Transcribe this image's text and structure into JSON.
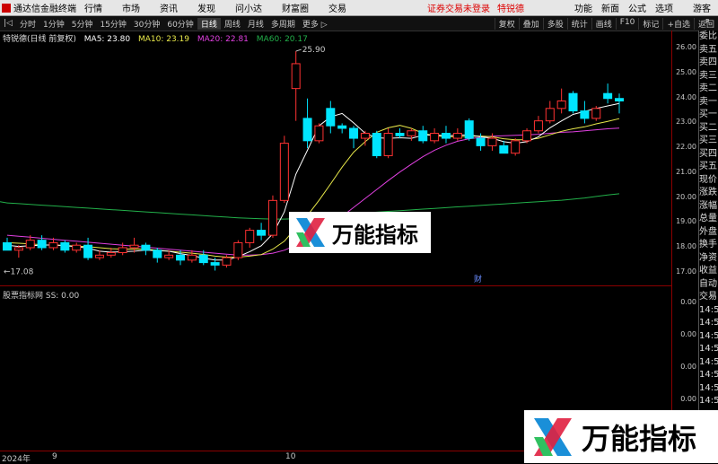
{
  "menubar": {
    "app_title": "通达信金融终端",
    "items": [
      "行情",
      "市场",
      "资讯",
      "发现",
      "问小达",
      "财富圈",
      "交易"
    ],
    "notice": "证券交易未登录",
    "badge": "特锐德",
    "right_items": [
      "功能",
      "新面",
      "公式",
      "选项"
    ],
    "user": "游客"
  },
  "toolbar": {
    "left": [
      "|◁",
      "分时",
      "1分钟",
      "5分钟",
      "15分钟",
      "30分钟",
      "60分钟",
      "日线",
      "周线",
      "月线",
      "多周期",
      "更多 ▷"
    ],
    "active": "日线",
    "right": [
      "复权",
      "叠加",
      "多股",
      "统计",
      "画线",
      "F10",
      "标记",
      "+自选",
      "返回"
    ]
  },
  "legend": {
    "title": "特锐德(日线 前复权)",
    "ma5": "MA5: 23.80",
    "ma10": "MA10: 23.19",
    "ma20": "MA20: 22.81",
    "ma60": "MA60: 20.17"
  },
  "colors": {
    "up": "#ff3232",
    "down": "#00e5ff",
    "ma5": "#ffffff",
    "ma10": "#e8e84a",
    "ma20": "#e040e0",
    "ma60": "#22b04a",
    "axis": "#8b0000"
  },
  "chart_data": {
    "type": "candlestick",
    "ylim": [
      16.7,
      26.3
    ],
    "yticks": [
      "26.00",
      "25.00",
      "24.00",
      "23.00",
      "22.00",
      "21.00",
      "20.00",
      "19.00",
      "18.00",
      "17.00"
    ],
    "high_label": "25.90",
    "low_label": "←17.08",
    "marker": "财",
    "candles": [
      [
        18.2,
        18.4,
        17.9,
        17.9
      ],
      [
        17.9,
        18.1,
        17.6,
        18.0
      ],
      [
        18.0,
        18.5,
        17.9,
        18.3
      ],
      [
        18.3,
        18.5,
        17.9,
        18.0
      ],
      [
        18.0,
        18.4,
        17.9,
        18.2
      ],
      [
        18.2,
        18.3,
        17.8,
        17.9
      ],
      [
        17.9,
        18.2,
        17.8,
        18.1
      ],
      [
        18.1,
        18.4,
        17.5,
        17.6
      ],
      [
        17.6,
        17.9,
        17.5,
        17.7
      ],
      [
        17.7,
        18.0,
        17.6,
        17.8
      ],
      [
        17.8,
        18.2,
        17.7,
        18.0
      ],
      [
        18.0,
        18.4,
        17.8,
        18.1
      ],
      [
        18.1,
        18.2,
        17.7,
        17.9
      ],
      [
        17.9,
        18.0,
        17.4,
        17.6
      ],
      [
        17.6,
        17.9,
        17.5,
        17.7
      ],
      [
        17.7,
        17.9,
        17.3,
        17.5
      ],
      [
        17.5,
        17.9,
        17.4,
        17.7
      ],
      [
        17.7,
        17.9,
        17.3,
        17.4
      ],
      [
        17.4,
        17.6,
        17.08,
        17.3
      ],
      [
        17.3,
        17.7,
        17.2,
        17.6
      ],
      [
        17.6,
        18.3,
        17.5,
        18.2
      ],
      [
        18.2,
        18.8,
        18.0,
        18.7
      ],
      [
        18.7,
        19.0,
        18.3,
        18.5
      ],
      [
        18.5,
        20.1,
        18.4,
        19.9
      ],
      [
        19.9,
        22.5,
        19.8,
        22.2
      ],
      [
        24.4,
        25.9,
        23.1,
        25.4
      ],
      [
        23.2,
        24.0,
        22.0,
        22.3
      ],
      [
        22.3,
        23.0,
        22.2,
        22.9
      ],
      [
        23.6,
        23.9,
        22.6,
        22.9
      ],
      [
        22.9,
        23.0,
        22.6,
        22.8
      ],
      [
        22.8,
        22.9,
        22.0,
        22.4
      ],
      [
        22.4,
        22.7,
        22.1,
        22.6
      ],
      [
        22.6,
        22.7,
        21.6,
        21.7
      ],
      [
        21.7,
        22.8,
        21.6,
        22.6
      ],
      [
        22.6,
        22.8,
        22.4,
        22.5
      ],
      [
        22.5,
        22.8,
        22.3,
        22.7
      ],
      [
        22.7,
        22.9,
        22.2,
        22.3
      ],
      [
        22.3,
        22.8,
        22.2,
        22.6
      ],
      [
        22.6,
        22.9,
        22.2,
        22.4
      ],
      [
        22.4,
        22.8,
        22.3,
        22.6
      ],
      [
        23.1,
        23.2,
        22.3,
        22.4
      ],
      [
        22.4,
        22.6,
        21.9,
        22.1
      ],
      [
        22.1,
        22.6,
        21.9,
        22.4
      ],
      [
        22.1,
        22.3,
        21.8,
        21.8
      ],
      [
        21.8,
        22.4,
        21.7,
        22.3
      ],
      [
        22.3,
        22.8,
        22.2,
        22.7
      ],
      [
        22.7,
        23.3,
        22.6,
        23.1
      ],
      [
        23.1,
        23.9,
        23.0,
        23.6
      ],
      [
        23.6,
        24.4,
        23.4,
        23.9
      ],
      [
        24.2,
        24.3,
        23.4,
        23.5
      ],
      [
        23.5,
        23.9,
        23.0,
        23.2
      ],
      [
        23.2,
        23.7,
        23.1,
        23.6
      ],
      [
        24.2,
        24.6,
        23.8,
        24.0
      ],
      [
        24.0,
        24.2,
        23.4,
        23.9
      ]
    ],
    "ma5": [
      18.1,
      18.05,
      18.08,
      18.1,
      18.12,
      18.08,
      18.04,
      17.98,
      17.86,
      17.82,
      17.84,
      17.86,
      17.9,
      17.88,
      17.86,
      17.76,
      17.68,
      17.58,
      17.5,
      17.5,
      17.64,
      17.84,
      18.08,
      18.56,
      19.44,
      20.96,
      21.92,
      22.9,
      23.26,
      23.4,
      23.02,
      22.6,
      22.42,
      22.4,
      22.42,
      22.4,
      22.52,
      22.54,
      22.5,
      22.52,
      22.54,
      22.46,
      22.4,
      22.26,
      22.2,
      22.26,
      22.46,
      22.82,
      23.1,
      23.36,
      23.48,
      23.6,
      23.7,
      23.8
    ],
    "ma10": [
      18.2,
      18.18,
      18.15,
      18.12,
      18.1,
      18.09,
      18.06,
      18.04,
      18.0,
      17.96,
      17.94,
      17.95,
      17.94,
      17.9,
      17.86,
      17.82,
      17.78,
      17.73,
      17.66,
      17.62,
      17.62,
      17.66,
      17.72,
      17.94,
      18.26,
      18.8,
      19.3,
      19.9,
      20.56,
      21.24,
      21.84,
      22.26,
      22.64,
      22.82,
      22.92,
      22.8,
      22.6,
      22.5,
      22.46,
      22.46,
      22.48,
      22.49,
      22.46,
      22.38,
      22.34,
      22.34,
      22.4,
      22.54,
      22.68,
      22.78,
      22.86,
      22.98,
      23.08,
      23.19
    ],
    "ma20": [
      18.5,
      18.46,
      18.42,
      18.38,
      18.34,
      18.3,
      18.26,
      18.22,
      18.18,
      18.14,
      18.1,
      18.06,
      18.02,
      17.98,
      17.94,
      17.9,
      17.86,
      17.82,
      17.78,
      17.74,
      17.7,
      17.7,
      17.72,
      17.78,
      17.9,
      18.1,
      18.34,
      18.6,
      18.92,
      19.26,
      19.62,
      19.98,
      20.34,
      20.7,
      21.04,
      21.36,
      21.66,
      21.92,
      22.12,
      22.28,
      22.38,
      22.44,
      22.48,
      22.5,
      22.52,
      22.54,
      22.56,
      22.6,
      22.64,
      22.66,
      22.7,
      22.74,
      22.78,
      22.81
    ],
    "ma60": [
      19.8,
      19.77,
      19.74,
      19.71,
      19.68,
      19.65,
      19.62,
      19.59,
      19.56,
      19.53,
      19.5,
      19.47,
      19.44,
      19.41,
      19.38,
      19.35,
      19.32,
      19.29,
      19.26,
      19.23,
      19.2,
      19.18,
      19.16,
      19.15,
      19.15,
      19.17,
      19.2,
      19.24,
      19.27,
      19.31,
      19.35,
      19.39,
      19.43,
      19.46,
      19.49,
      19.52,
      19.55,
      19.58,
      19.61,
      19.64,
      19.67,
      19.7,
      19.73,
      19.76,
      19.79,
      19.82,
      19.85,
      19.88,
      19.91,
      19.95,
      20.0,
      20.06,
      20.12,
      20.17
    ]
  },
  "sub": {
    "title": "股票指标网 SS: 0.00",
    "yticks": [
      "0.00",
      "0.00",
      "0.00",
      "0.00",
      "0.00"
    ]
  },
  "dates": [
    "2024年",
    "9",
    "10"
  ],
  "rightpanel": [
    "委比",
    "卖五",
    "卖四",
    "卖三",
    "卖二",
    "卖一",
    "买一",
    "买二",
    "买三",
    "买四",
    "买五",
    "现价",
    "涨跌",
    "涨幅",
    "总量",
    "外盘",
    "换手",
    "净资",
    "收益",
    "自动",
    "交易",
    "14:5",
    "14:5",
    "14:5",
    "14:5",
    "14:5",
    "14:5",
    "14:5",
    "14:5"
  ],
  "corner": "R",
  "watermark": "万能指标"
}
